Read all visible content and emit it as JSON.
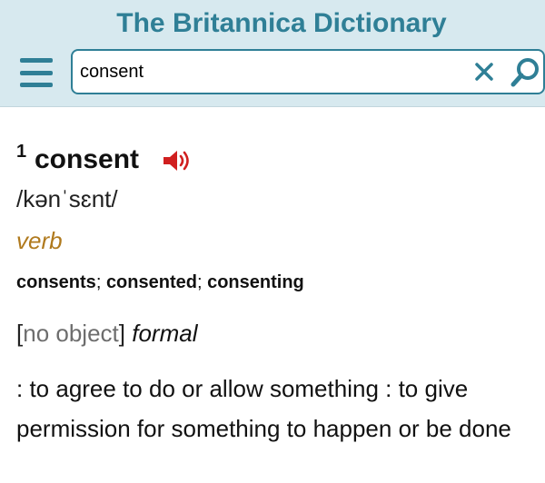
{
  "app": {
    "title": "The Britannica Dictionary"
  },
  "search": {
    "value": "consent"
  },
  "icons": {
    "menu": "hamburger-menu-icon",
    "clear": "close-icon",
    "search": "search-icon",
    "audio": "speaker-icon"
  },
  "colors": {
    "header_bg": "#d7e9ef",
    "brand": "#2f7f96",
    "audio": "#d01f1f",
    "part_of_speech": "#b07a1e",
    "grammar_note": "#6d6d6d"
  },
  "entry": {
    "homograph": "1",
    "headword": "consent",
    "pronunciation": "/kənˈsɛnt/",
    "part_of_speech": "verb",
    "inflections": [
      {
        "form": "consents",
        "sep": "; "
      },
      {
        "form": "consented",
        "sep": "; "
      },
      {
        "form": "consenting",
        "sep": ""
      }
    ],
    "usage": {
      "open": "[",
      "grammar": "no object",
      "close": "]",
      "label": "formal"
    },
    "definition": ": to agree to do or allow something : to give permission for something to happen or be done"
  }
}
